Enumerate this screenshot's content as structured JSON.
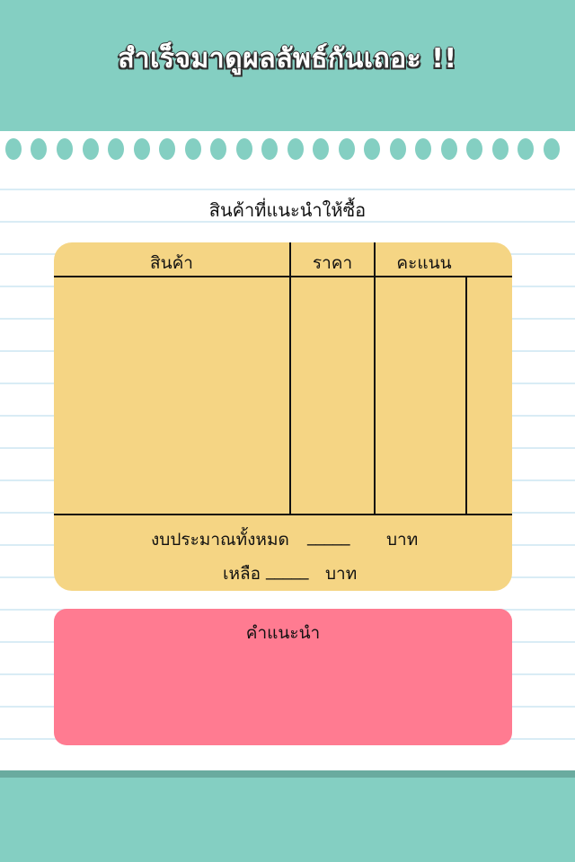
{
  "header": {
    "title": "สำเร็จมาดูผลลัพธ์กันเถอะ !!"
  },
  "section": {
    "title": "สินค้าที่แนะนำให้ซื้อ"
  },
  "table": {
    "columns": [
      "สินค้า",
      "ราคา",
      "คะแนน"
    ],
    "budget_label": "งบประมาณทั้งหมด",
    "budget_value": "_____",
    "budget_unit": "บาท",
    "remain_label": "เหลือ",
    "remain_value": "_____",
    "remain_unit": "บาท"
  },
  "advice": {
    "title": "คำแนะนำ"
  },
  "colors": {
    "background_teal": "#84cfc2",
    "table_card": "#f5d584",
    "advice_card": "#ff7b91"
  }
}
